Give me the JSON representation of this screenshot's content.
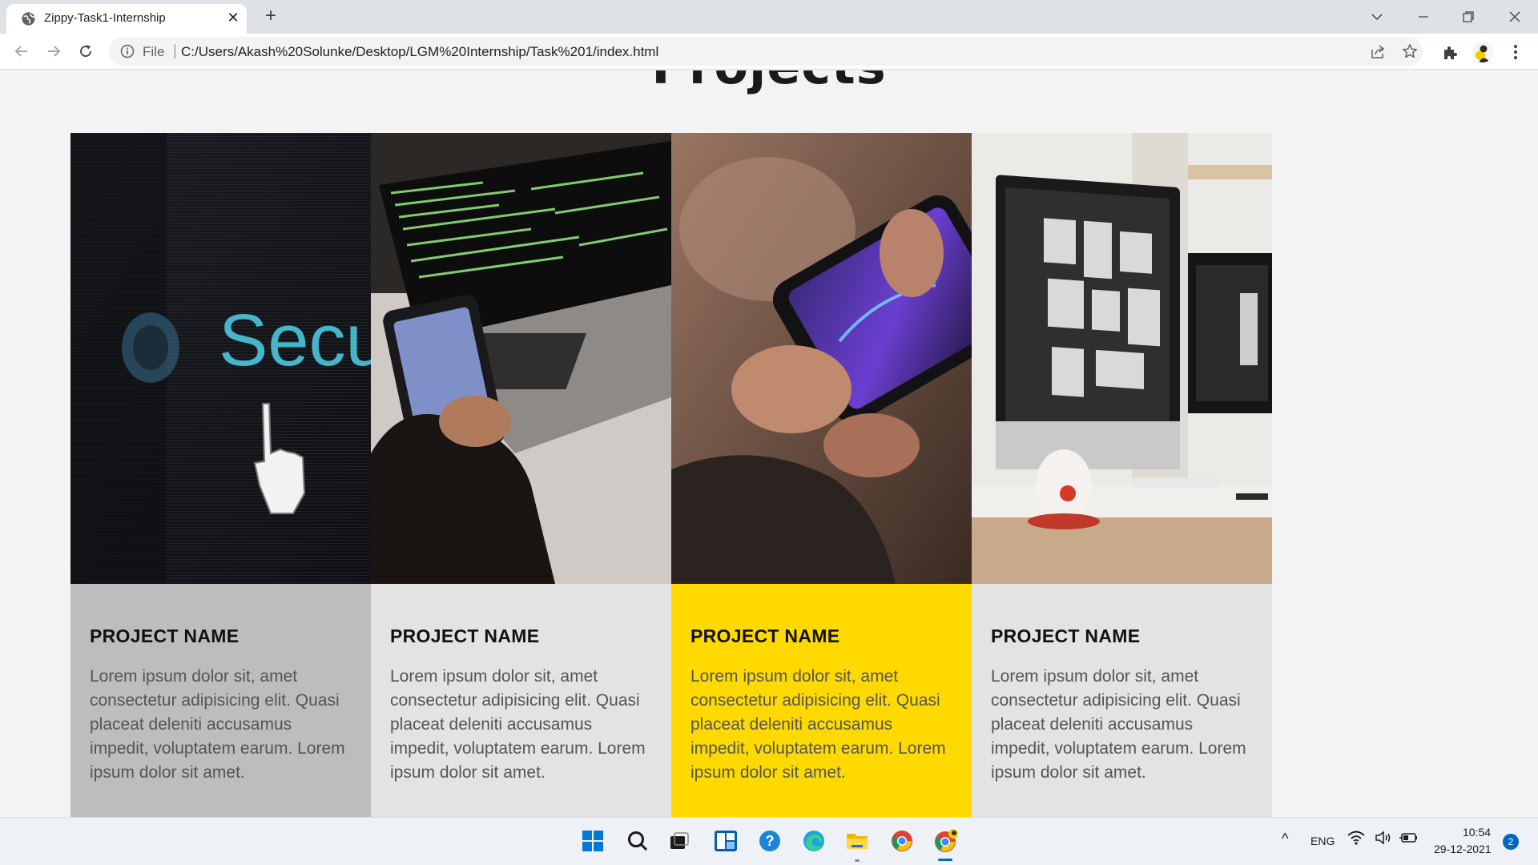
{
  "browser": {
    "tab_title": "Zippy-Task1-Internship",
    "tab_close_glyph": "✕",
    "new_tab_glyph": "+",
    "url_scheme": "File",
    "url_separator": "|",
    "url": "C:/Users/Akash%20Solunke/Desktop/LGM%20Internship/Task%201/index.html",
    "icons": [
      "globe-icon",
      "tab-search-icon",
      "minimize-icon",
      "restore-icon",
      "close-icon",
      "back-icon",
      "forward-icon",
      "reload-icon",
      "info-icon",
      "share-icon",
      "star-icon",
      "extensions-icon",
      "menu-icon"
    ]
  },
  "page": {
    "section_title": "Projects",
    "projects": [
      {
        "name": "PROJECT NAME",
        "description": "Lorem ipsum dolor sit, amet consectetur adipisicing elit. Quasi placeat deleniti accusamus impedit, voluptatem earum. Lorem ipsum dolor sit amet.",
        "image": "security-screen-photo",
        "background": "#bdbdbd",
        "text_color": "#555555"
      },
      {
        "name": "PROJECT NAME",
        "description": "Lorem ipsum dolor sit, amet consectetur adipisicing elit. Quasi placeat deleniti accusamus impedit, voluptatem earum. Lorem ipsum dolor sit amet.",
        "image": "laptop-code-phone-photo",
        "background": "#e3e3e3",
        "text_color": "#555555"
      },
      {
        "name": "PROJECT NAME",
        "description": "Lorem ipsum dolor sit, amet consectetur adipisicing elit. Quasi placeat deleniti accusamus impedit, voluptatem earum. Lorem ipsum dolor sit amet.",
        "image": "mobile-gaming-photo",
        "background": "#ffd900",
        "text_color": "#555555"
      },
      {
        "name": "PROJECT NAME",
        "description": "Lorem ipsum dolor sit, amet consectetur adipisicing elit. Quasi placeat deleniti accusamus impedit, voluptatem earum. Lorem ipsum dolor sit amet.",
        "image": "desk-monitors-photo",
        "background": "#e3e3e3",
        "text_color": "#555555"
      }
    ]
  },
  "taskbar": {
    "apps": [
      "start-icon",
      "search-icon",
      "task-view-icon",
      "widgets-icon",
      "help-icon",
      "edge-icon",
      "file-explorer-icon",
      "chrome-icon",
      "chrome-profile-icon"
    ],
    "tray_chevron": "^",
    "language": "ENG",
    "time": "10:54",
    "date": "29-12-2021",
    "notification_count": "2",
    "accent_color": "#0067c0"
  }
}
